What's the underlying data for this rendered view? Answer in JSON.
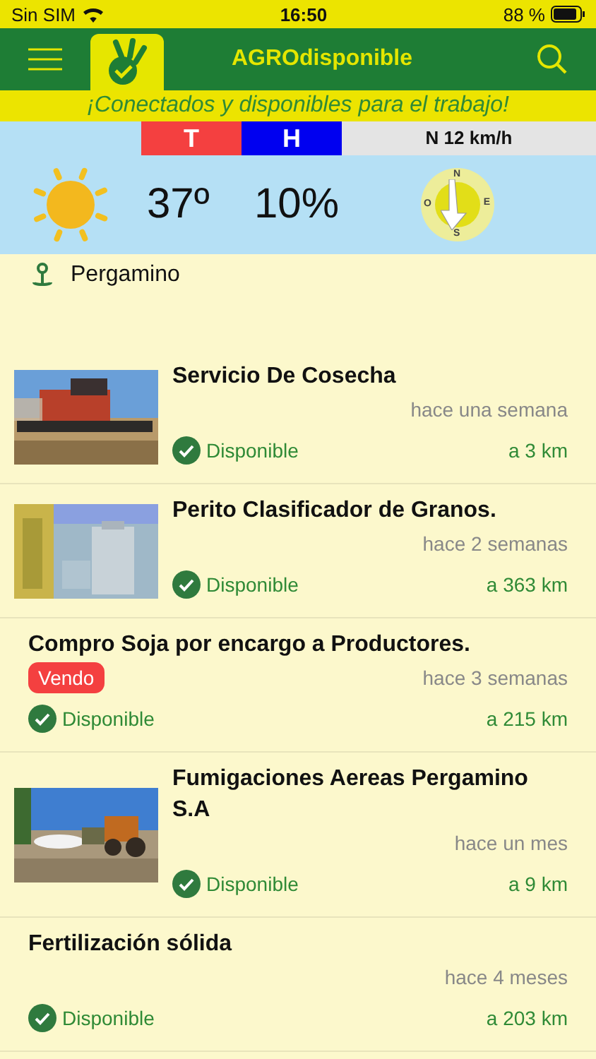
{
  "status_bar": {
    "carrier": "Sin SIM",
    "time": "16:50",
    "battery": "88 %"
  },
  "nav": {
    "title": "AGROdisponible"
  },
  "slogan": "¡Conectados y disponibles para el trabajo!",
  "weather": {
    "t_label": "T",
    "h_label": "H",
    "wind": "N 12 km/h",
    "temperature": "37º",
    "humidity": "10%",
    "compass": [
      "N",
      "E",
      "S",
      "O"
    ]
  },
  "location": "Pergamino",
  "items": [
    {
      "title": "Servicio De Cosecha",
      "time": "hace una semana",
      "status": "Disponible",
      "distance": "a 3 km"
    },
    {
      "title": "Perito Clasificador de Granos.",
      "time": "hace 2 semanas",
      "status": "Disponible",
      "distance": "a 363 km"
    },
    {
      "kind": "text",
      "title": "Compro Soja por encargo a Productores.",
      "tag": "Vendo",
      "time": "hace 3 semanas",
      "status": "Disponible",
      "distance": "a 215 km"
    },
    {
      "title": "Fumigaciones Aereas Pergamino S.A",
      "time": "hace un mes",
      "status": "Disponible",
      "distance": "a 9 km"
    },
    {
      "kind": "text",
      "title": "Fertilización sólida",
      "time": "hace 4 meses",
      "status": "Disponible",
      "distance": "a 203 km"
    }
  ]
}
